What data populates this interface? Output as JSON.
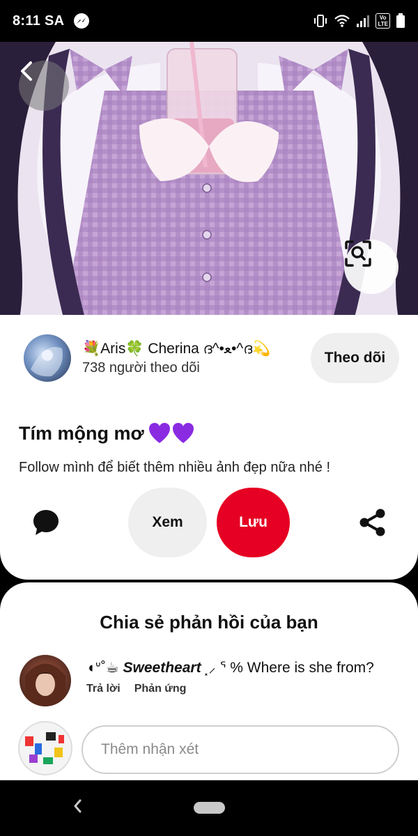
{
  "status_bar": {
    "time": "8:11 SA",
    "lte_top": "Vo",
    "lte_bottom": "LTE"
  },
  "icons": {
    "back": "chevron-left-icon",
    "visual_search": "visual-search-icon",
    "comment": "comment-bubble-icon",
    "share": "share-icon",
    "heart": "purple-heart-icon"
  },
  "creator": {
    "name": "💐Aris🍀 Cherina ദ^•ﻌ•^ദ💫",
    "followers": "738 người theo dõi",
    "follow_label": "Theo dõi"
  },
  "pin": {
    "title": "Tím mộng mơ",
    "description": "Follow mình để biết thêm nhiều ảnh đẹp nữa nhé !",
    "view_label": "Xem",
    "save_label": "Lưu"
  },
  "comments": {
    "title": "Chia sẻ phản hồi của bạn",
    "items": [
      {
        "prefix": "◖ᐡ˚☕",
        "author": "Sweetheart",
        "suffix": "⸼⸝ ᕐ %",
        "text": "Where is she from?",
        "reply_label": "Trả lời",
        "react_label": "Phản ứng"
      }
    ],
    "input_placeholder": "Thêm nhận xét"
  },
  "colors": {
    "save_red": "#e60023",
    "button_gray": "#efefef",
    "heart_purple": "#8a2be2"
  }
}
